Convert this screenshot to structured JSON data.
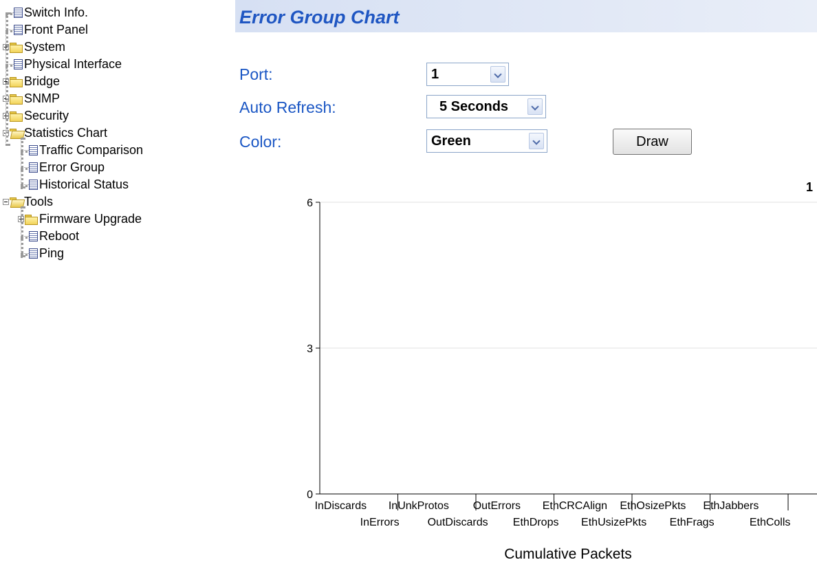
{
  "tree": [
    {
      "label": "Switch Info.",
      "type": "page"
    },
    {
      "label": "Front Panel",
      "type": "page"
    },
    {
      "label": "System",
      "type": "folder",
      "expanded": false
    },
    {
      "label": "Physical Interface",
      "type": "page"
    },
    {
      "label": "Bridge",
      "type": "folder",
      "expanded": false
    },
    {
      "label": "SNMP",
      "type": "folder",
      "expanded": false
    },
    {
      "label": "Security",
      "type": "folder",
      "expanded": false
    },
    {
      "label": "Statistics Chart",
      "type": "folder",
      "expanded": true,
      "children": [
        {
          "label": "Traffic Comparison"
        },
        {
          "label": "Error Group"
        },
        {
          "label": "Historical Status"
        }
      ]
    },
    {
      "label": "Tools",
      "type": "folder",
      "expanded": true,
      "children": [
        {
          "label": "Firmware Upgrade",
          "type": "folder"
        },
        {
          "label": "Reboot"
        },
        {
          "label": "Ping"
        }
      ]
    }
  ],
  "header": {
    "title": "Error Group Chart"
  },
  "form": {
    "port_label": "Port:",
    "port_value": "1",
    "refresh_label": "Auto Refresh:",
    "refresh_value": "5 Seconds",
    "color_label": "Color:",
    "color_value": "Green",
    "draw_label": "Draw"
  },
  "chart_data": {
    "type": "bar",
    "title": "1",
    "xlabel": "Cumulative Packets",
    "ylabel": "",
    "ylim": [
      0,
      6
    ],
    "yticks": [
      "0",
      "3",
      "6"
    ],
    "grid": true,
    "bar_color": "#00a000",
    "categories": [
      "InDiscards",
      "InErrors",
      "InUnkProtos",
      "OutDiscards",
      "OutErrors",
      "EthDrops",
      "EthCRCAlign",
      "EthUsizePkts",
      "EthOsizePkts",
      "EthFrags",
      "EthJabbers",
      "EthColls"
    ],
    "values": [
      0,
      0,
      0,
      0,
      0,
      0,
      0,
      0,
      0,
      0,
      0,
      0
    ]
  }
}
